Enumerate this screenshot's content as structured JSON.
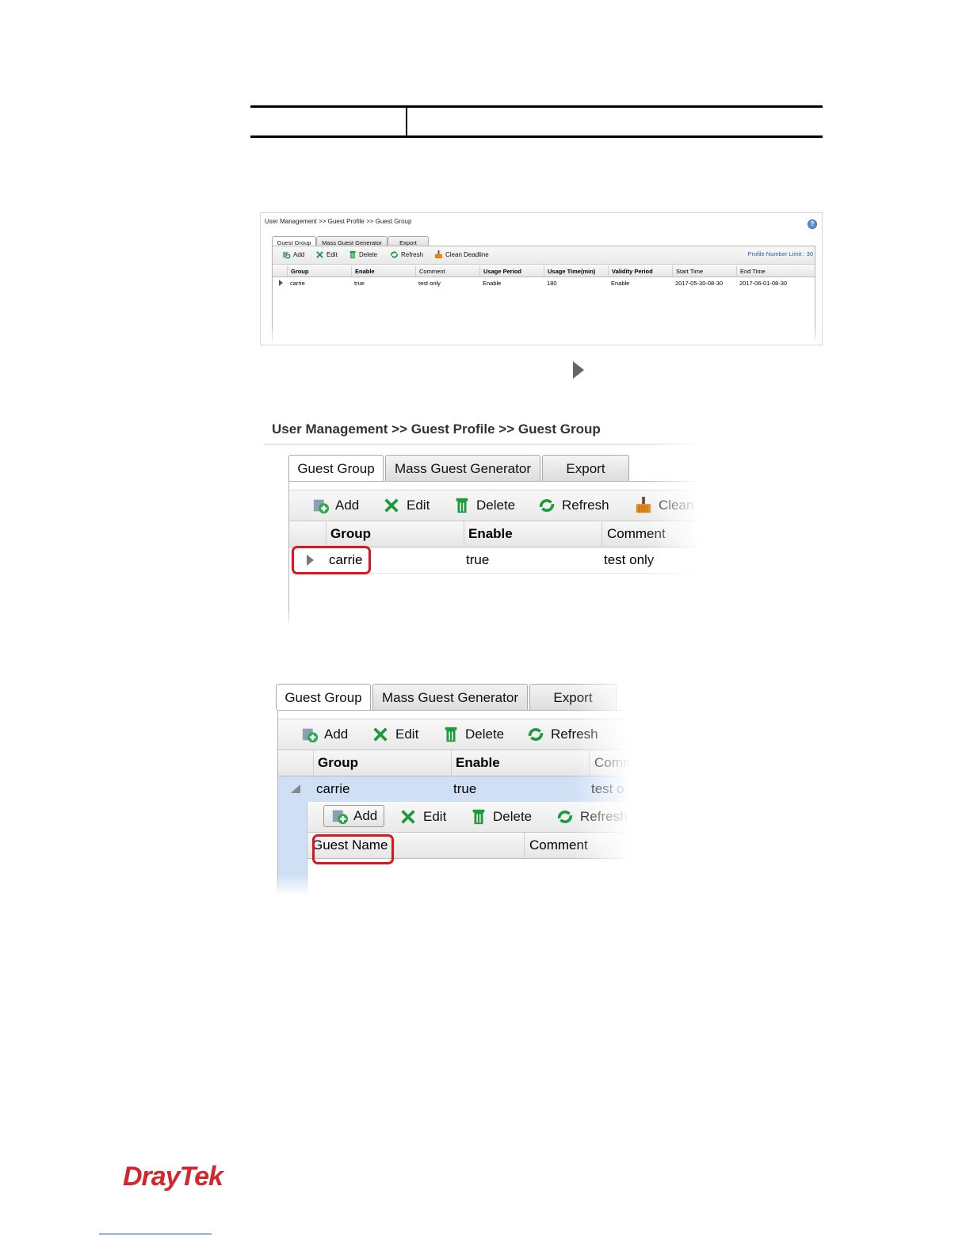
{
  "shot1": {
    "breadcrumb": "User Management >> Guest Profile >> Guest Group",
    "help_icon": "?",
    "tabs": [
      "Guest Group",
      "Mass Guest Generator",
      "Export"
    ],
    "toolbar": [
      "Add",
      "Edit",
      "Delete",
      "Refresh",
      "Clean Deadline"
    ],
    "profile_limit": "Profile Number Limit : 30",
    "columns": [
      "Group",
      "Enable",
      "Comment",
      "Usage Period",
      "Usage Time(min)",
      "Validity Period",
      "Start Time",
      "End Time"
    ],
    "rows": [
      [
        "carrie",
        "true",
        "test only",
        "Enable",
        "180",
        "Enable",
        "2017-05-30-08-30",
        "2017-06-01-08-30"
      ]
    ]
  },
  "shot2": {
    "breadcrumb": "User Management >> Guest Profile >> Guest Group",
    "tabs": [
      "Guest Group",
      "Mass Guest Generator",
      "Export"
    ],
    "toolbar": [
      "Add",
      "Edit",
      "Delete",
      "Refresh",
      "Clean"
    ],
    "columns": [
      "Group",
      "Enable",
      "Comment"
    ],
    "row": [
      "carrie",
      "true",
      "test only"
    ]
  },
  "shot3": {
    "tabs": [
      "Guest Group",
      "Mass Guest Generator",
      "Export"
    ],
    "toolbar": [
      "Add",
      "Edit",
      "Delete",
      "Refresh"
    ],
    "columns": [
      "Group",
      "Enable",
      "Comm"
    ],
    "row": [
      "carrie",
      "true",
      "test o"
    ],
    "sub_toolbar": [
      "Add",
      "Edit",
      "Delete",
      "Refresh"
    ],
    "sub_columns": [
      "Guest Name",
      "Comment"
    ]
  },
  "logo": "DrayTek",
  "colors": {
    "highlight": "#e0141e",
    "brand": "#d3262e",
    "link_blue": "#2a62b5",
    "expanded_row": "#cfe0f5"
  }
}
